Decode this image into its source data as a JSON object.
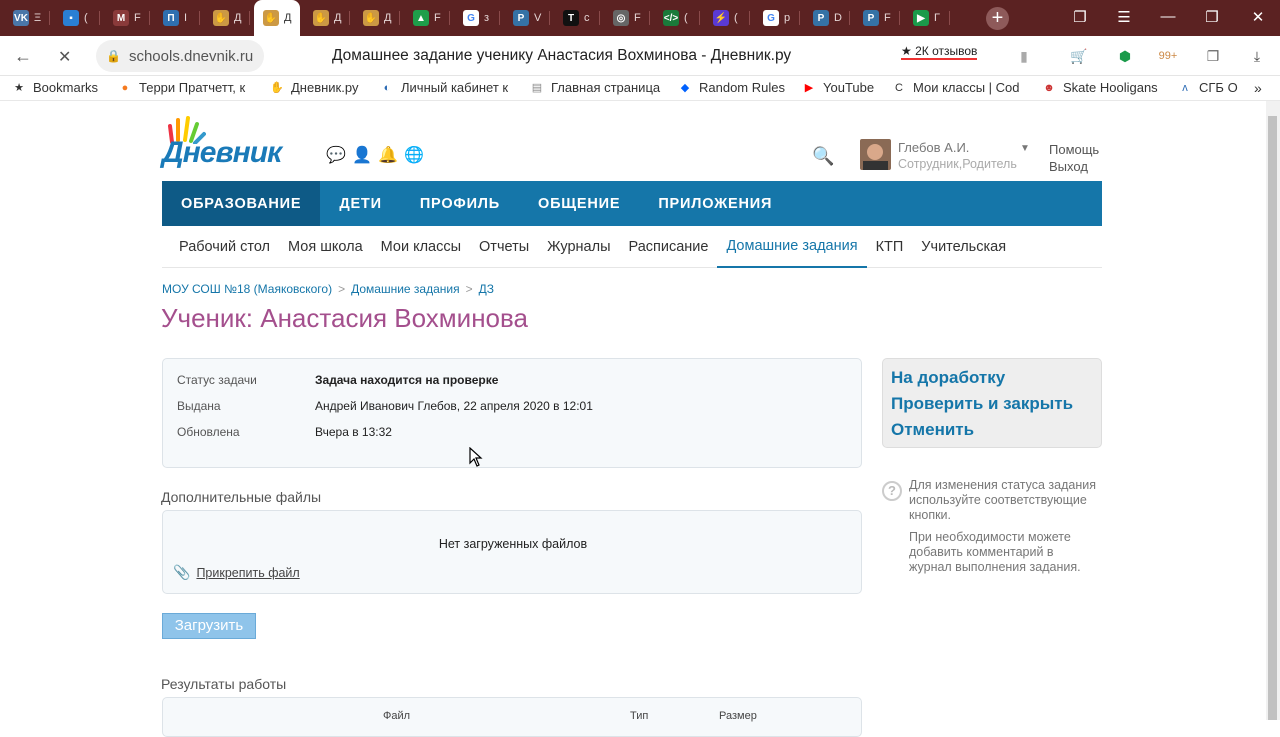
{
  "browser": {
    "tabs": [
      {
        "icon": "vk-icon",
        "color": "#4a76a8",
        "glyph": "VK",
        "label": "Ξ"
      },
      {
        "icon": "chat-icon",
        "color": "#2a7fd4",
        "glyph": "▪",
        "label": "("
      },
      {
        "icon": "mail-icon",
        "color": "#8a3a3a",
        "glyph": "M",
        "label": "F"
      },
      {
        "icon": "notion-icon",
        "color": "#2f6fb0",
        "glyph": "П",
        "label": "I"
      },
      {
        "icon": "dnevnik-hand-icon",
        "color": "#c94",
        "glyph": "✋",
        "label": "Д"
      },
      {
        "icon": "dnevnik-hand-icon",
        "color": "#c94",
        "glyph": "✋",
        "label": "Д",
        "active": true
      },
      {
        "icon": "dnevnik-hand-icon",
        "color": "#c94",
        "glyph": "✋",
        "label": "Д"
      },
      {
        "icon": "dnevnik-hand-icon",
        "color": "#c94",
        "glyph": "✋",
        "label": "Д"
      },
      {
        "icon": "drive-icon",
        "color": "#1e9e4a",
        "glyph": "▲",
        "label": "F"
      },
      {
        "icon": "google-icon",
        "color": "#fff",
        "glyph": "G",
        "label": "з"
      },
      {
        "icon": "python-icon",
        "color": "#3572a5",
        "glyph": "P",
        "label": "V"
      },
      {
        "icon": "t-icon",
        "color": "#111",
        "glyph": "T",
        "label": "c"
      },
      {
        "icon": "settings-circle-icon",
        "color": "#666",
        "glyph": "◎",
        "label": "F"
      },
      {
        "icon": "code-icon",
        "color": "#1a7a3a",
        "glyph": "</>",
        "label": "("
      },
      {
        "icon": "bolt-icon",
        "color": "#5a3ad4",
        "glyph": "⚡",
        "label": "("
      },
      {
        "icon": "google-icon",
        "color": "#fff",
        "glyph": "G",
        "label": "р"
      },
      {
        "icon": "python-icon",
        "color": "#3572a5",
        "glyph": "P",
        "label": "D"
      },
      {
        "icon": "python-icon",
        "color": "#3572a5",
        "glyph": "P",
        "label": "F"
      },
      {
        "icon": "play-icon",
        "color": "#1a9a4a",
        "glyph": "▶",
        "label": "Г"
      }
    ],
    "url": "schools.dnevnik.ru",
    "page_title": "Домашнее задание ученику Анастасия Вохминова - Дневник.ру",
    "reviews": "★ 2К отзывов",
    "bookmarks": [
      {
        "icon": "star-icon",
        "label": "Bookmarks"
      },
      {
        "icon": "ok-icon",
        "label": "Терри Пратчетт, к"
      },
      {
        "icon": "dnevnik-hand-icon",
        "label": "Дневник.ру"
      },
      {
        "icon": "globe-icon",
        "label": "Личный кабинет к"
      },
      {
        "icon": "page-icon",
        "label": "Главная страница"
      },
      {
        "icon": "dropbox-icon",
        "label": "Random Rules"
      },
      {
        "icon": "youtube-icon",
        "label": "YouTube"
      },
      {
        "icon": "code-icon",
        "label": "Мои классы | Cod"
      },
      {
        "icon": "skate-icon",
        "label": "Skate Hooligans"
      },
      {
        "icon": "sgb-icon",
        "label": "СГБ О"
      }
    ]
  },
  "site": {
    "logo": "Дневник",
    "user": {
      "name": "Глебов А.И.",
      "role": "Сотрудник,Родитель"
    },
    "help": "Помощь",
    "logout": "Выход",
    "main_nav": [
      {
        "label": "ОБРАЗОВАНИЕ",
        "active": true
      },
      {
        "label": "ДЕТИ"
      },
      {
        "label": "ПРОФИЛЬ"
      },
      {
        "label": "ОБЩЕНИЕ"
      },
      {
        "label": "ПРИЛОЖЕНИЯ"
      }
    ],
    "sub_nav": [
      {
        "label": "Рабочий стол"
      },
      {
        "label": "Моя школа"
      },
      {
        "label": "Мои классы"
      },
      {
        "label": "Отчеты"
      },
      {
        "label": "Журналы"
      },
      {
        "label": "Расписание"
      },
      {
        "label": "Домашние задания",
        "active": true
      },
      {
        "label": "КТП"
      },
      {
        "label": "Учительская"
      }
    ]
  },
  "breadcrumb": [
    "МОУ СОШ №18 (Маяковского)",
    "Домашние задания",
    "ДЗ"
  ],
  "heading": "Ученик: Анастасия Вохминова",
  "status": {
    "rows": [
      {
        "label": "Статус задачи",
        "value": "Задача находится на проверке",
        "bold": true
      },
      {
        "label": "Выдана",
        "value": "Андрей Иванович Глебов, 22 апреля 2020 в 12:01"
      },
      {
        "label": "Обновлена",
        "value": "Вчера в 13:32"
      }
    ]
  },
  "actions": [
    "На доработку",
    "Проверить и закрыть",
    "Отменить"
  ],
  "hint": {
    "p1": "Для изменения статуса задания используйте соответствующие кнопки.",
    "p2": "При необходимости можете добавить комментарий в журнал выполнения задания."
  },
  "files": {
    "title": "Дополнительные файлы",
    "empty": "Нет загруженных файлов",
    "attach": "Прикрепить файл",
    "upload": "Загрузить"
  },
  "results": {
    "title": "Результаты работы",
    "columns": [
      "Файл",
      "Тип",
      "Размер"
    ]
  }
}
